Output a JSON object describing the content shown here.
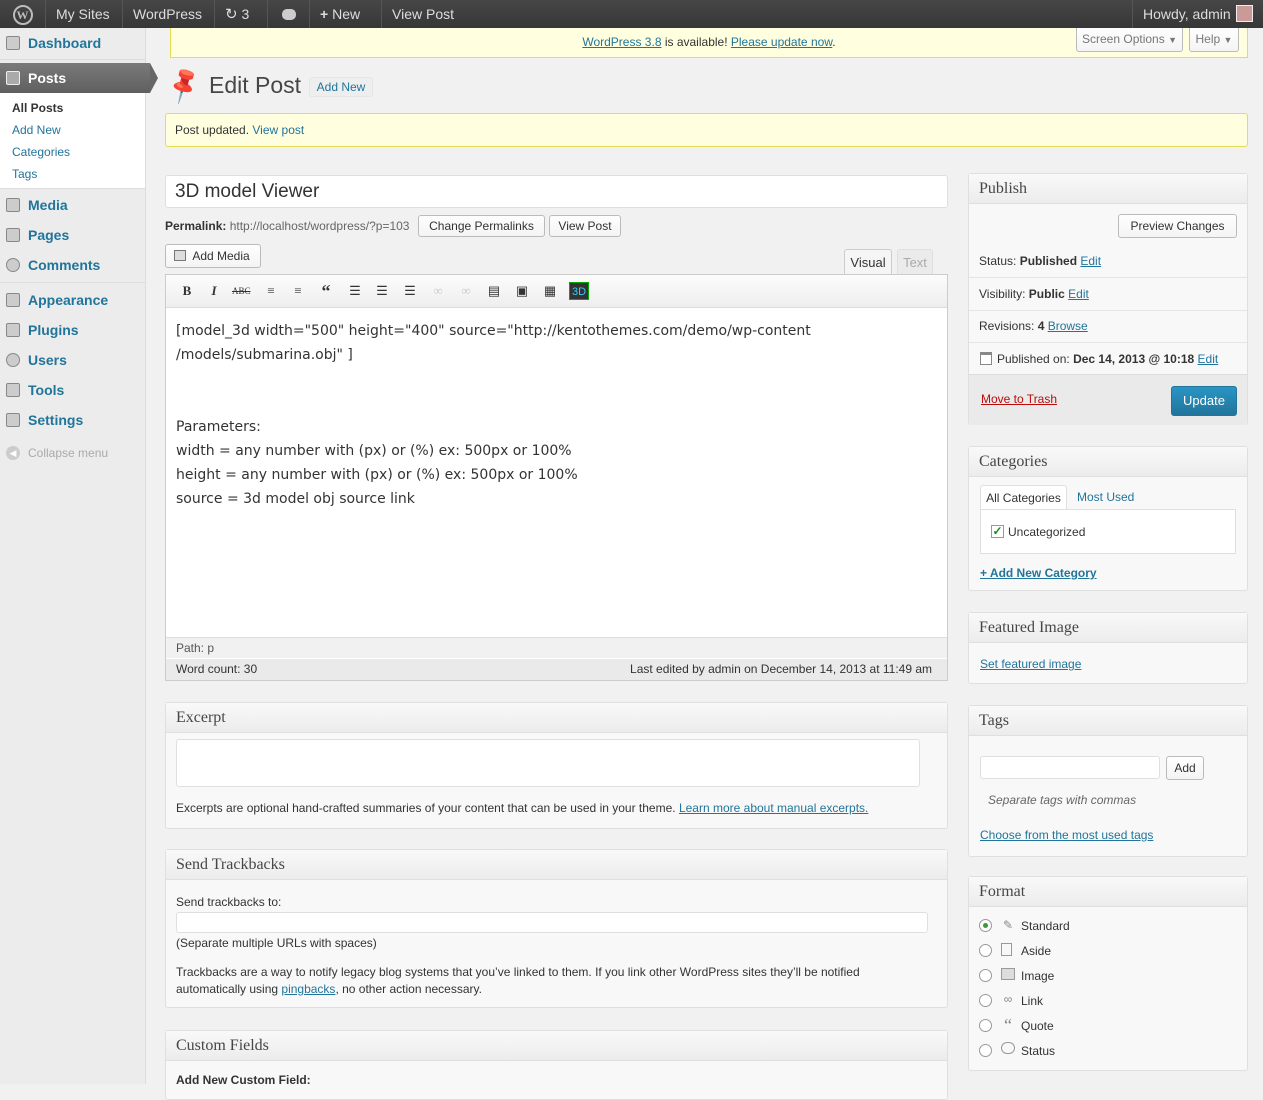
{
  "adminbar": {
    "my_sites": "My Sites",
    "site": "WordPress",
    "updates": "3",
    "new": "New",
    "view_post": "View Post",
    "howdy": "Howdy, admin"
  },
  "menu": {
    "dashboard": "Dashboard",
    "posts": "Posts",
    "posts_sub": [
      "All Posts",
      "Add New",
      "Categories",
      "Tags"
    ],
    "media": "Media",
    "pages": "Pages",
    "comments": "Comments",
    "appearance": "Appearance",
    "plugins": "Plugins",
    "users": "Users",
    "tools": "Tools",
    "settings": "Settings",
    "collapse": "Collapse menu"
  },
  "update_notice": {
    "link": "WordPress 3.8",
    "text": " is available! ",
    "update": "Please update now",
    "end": "."
  },
  "screen_options": "Screen Options",
  "help": "Help",
  "page_title": "Edit Post",
  "add_new": "Add New",
  "updated_notice": {
    "text": "Post updated. ",
    "link": "View post"
  },
  "post": {
    "title": "3D model Viewer",
    "permalink_label": "Permalink:",
    "permalink_url": "http://localhost/wordpress/?p=103",
    "change_permalinks": "Change Permalinks",
    "view_post": "View Post",
    "add_media": "Add Media",
    "tab_visual": "Visual",
    "tab_text": "Text",
    "content_lines": [
      "[model_3d width=\"500\" height=\"400\" source=\"http://kentothemes.com/demo/wp-content",
      "/models/submarina.obj\" ]",
      "",
      "",
      "Parameters:",
      "width = any number with (px) or (%) ex: 500px or 100%",
      "height = any number with (px) or (%) ex: 500px or 100%",
      "source = 3d model obj source link"
    ],
    "path": "Path: p",
    "word_count": "Word count: 30",
    "last_edited": "Last edited by admin on December 14, 2013 at 11:49 am"
  },
  "excerpt": {
    "title": "Excerpt",
    "help": "Excerpts are optional hand-crafted summaries of your content that can be used in your theme. ",
    "link": "Learn more about manual excerpts."
  },
  "trackbacks": {
    "title": "Send Trackbacks",
    "label": "Send trackbacks to:",
    "hint": "(Separate multiple URLs with spaces)",
    "desc1": "Trackbacks are a way to notify legacy blog systems that you’ve linked to them. If you link other WordPress sites they’ll be notified",
    "desc2_a": "automatically using ",
    "desc2_link": "pingbacks",
    "desc2_b": ", no other action necessary."
  },
  "custom_fields": {
    "title": "Custom Fields",
    "add_new": "Add New Custom Field:"
  },
  "publish": {
    "title": "Publish",
    "preview": "Preview Changes",
    "status_label": "Status: ",
    "status": "Published",
    "visibility_label": "Visibility: ",
    "visibility": "Public",
    "revisions_label": "Revisions: ",
    "revisions": "4",
    "browse": "Browse",
    "published_label": "Published on: ",
    "published": "Dec 14, 2013 @ 10:18",
    "edit": "Edit",
    "trash": "Move to Trash",
    "update": "Update"
  },
  "categories": {
    "title": "Categories",
    "tab_all": "All Categories",
    "tab_most": "Most Used",
    "item": "Uncategorized",
    "add": "+ Add New Category"
  },
  "featured": {
    "title": "Featured Image",
    "link": "Set featured image"
  },
  "tags": {
    "title": "Tags",
    "add": "Add",
    "hint": "Separate tags with commas",
    "choose": "Choose from the most used tags"
  },
  "format": {
    "title": "Format",
    "options": [
      "Standard",
      "Aside",
      "Image",
      "Link",
      "Quote",
      "Status"
    ],
    "selected": "Standard"
  }
}
